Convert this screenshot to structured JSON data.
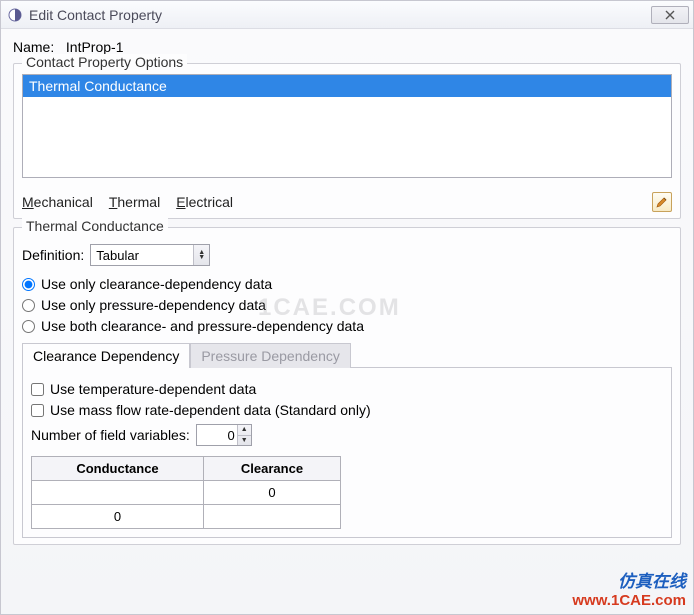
{
  "window": {
    "title": "Edit Contact Property"
  },
  "name": {
    "label": "Name:",
    "value": "IntProp-1"
  },
  "options_group": {
    "title": "Contact Property Options"
  },
  "options_list": [
    "Thermal Conductance"
  ],
  "tabs": {
    "mechanical": "Mechanical",
    "thermal": "Thermal",
    "electrical": "Electrical"
  },
  "section": {
    "title": "Thermal Conductance"
  },
  "definition": {
    "label": "Definition:",
    "value": "Tabular"
  },
  "radios": {
    "r1": "Use only clearance-dependency data",
    "r2": "Use only pressure-dependency data",
    "r3": "Use both clearance- and pressure-dependency data"
  },
  "inner_tabs": {
    "t1": "Clearance Dependency",
    "t2": "Pressure Dependency"
  },
  "checks": {
    "c1": "Use temperature-dependent data",
    "c2": "Use mass flow rate-dependent data (Standard only)"
  },
  "numvar": {
    "label": "Number of field variables:",
    "value": "0"
  },
  "table": {
    "headers": [
      "Conductance",
      "Clearance"
    ],
    "rows": [
      [
        "",
        "0"
      ],
      [
        "0",
        ""
      ]
    ]
  },
  "watermark": {
    "center": "1CAE.COM",
    "line1": "仿真在线",
    "line2": "www.1CAE.com"
  }
}
